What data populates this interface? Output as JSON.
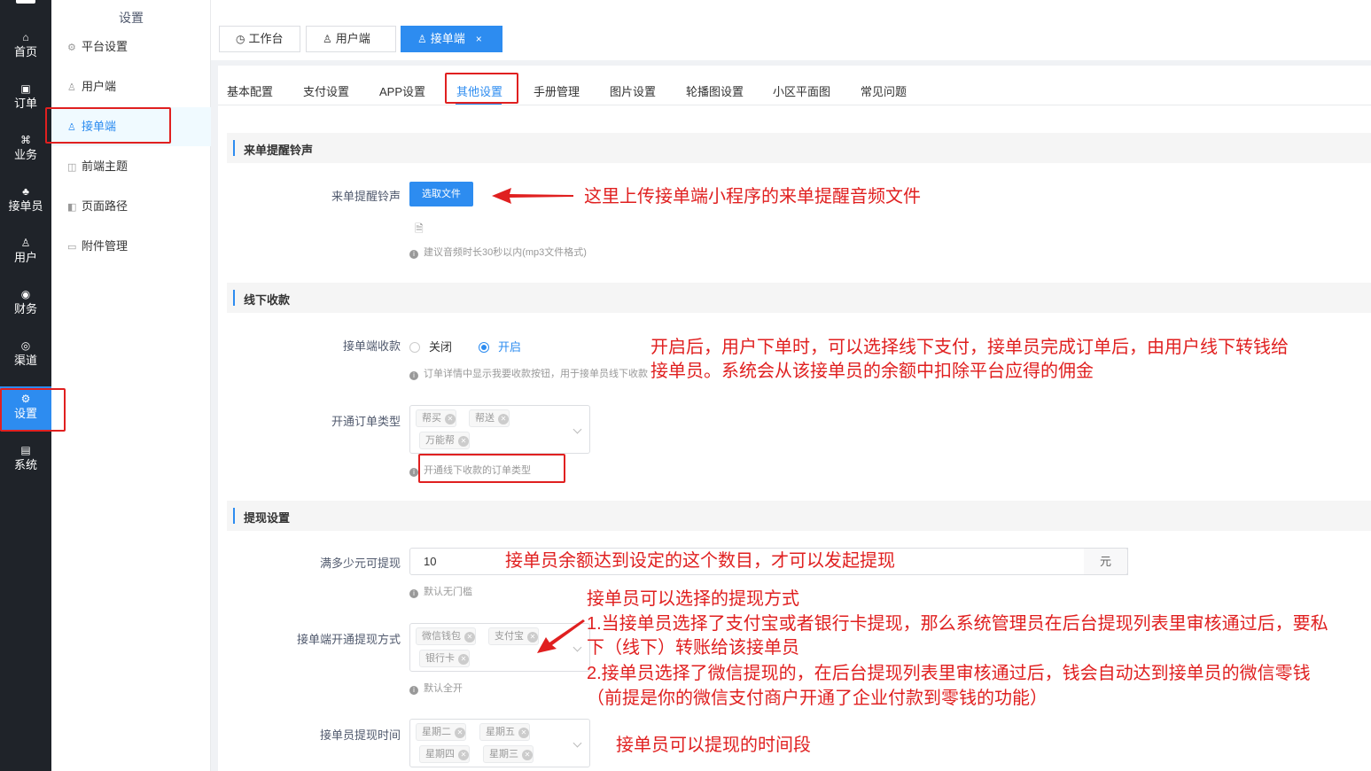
{
  "nav": {
    "items": [
      {
        "icon": "home-icon",
        "glyph": "⌂",
        "label": "首页"
      },
      {
        "icon": "order-icon",
        "glyph": "▣",
        "label": "订单"
      },
      {
        "icon": "business-icon",
        "glyph": "⌘",
        "label": "业务"
      },
      {
        "icon": "rider-icon",
        "glyph": "♣",
        "label": "接单员"
      },
      {
        "icon": "user-icon",
        "glyph": "♙",
        "label": "用户"
      },
      {
        "icon": "finance-icon",
        "glyph": "◉",
        "label": "财务"
      },
      {
        "icon": "channel-icon",
        "glyph": "◎",
        "label": "渠道"
      },
      {
        "icon": "settings-icon",
        "glyph": "⚙",
        "label": "设置"
      },
      {
        "icon": "system-icon",
        "glyph": "▤",
        "label": "系统"
      }
    ],
    "active_index": 7
  },
  "menu": {
    "title": "设置",
    "items": [
      {
        "icon": "gear-icon",
        "glyph": "⚙",
        "label": "平台设置"
      },
      {
        "icon": "user-icon",
        "glyph": "♙",
        "label": "用户端"
      },
      {
        "icon": "rider-icon",
        "glyph": "♙",
        "label": "接单端"
      },
      {
        "icon": "theme-icon",
        "glyph": "◫",
        "label": "前端主题"
      },
      {
        "icon": "path-icon",
        "glyph": "◧",
        "label": "页面路径"
      },
      {
        "icon": "archive-icon",
        "glyph": "▭",
        "label": "附件管理"
      }
    ],
    "active_index": 2
  },
  "page_tabs": {
    "workbench": "工作台",
    "user_client": "用户端",
    "order_client": "接单端",
    "close": "×"
  },
  "settings_tabs": [
    "基本配置",
    "支付设置",
    "APP设置",
    "其他设置",
    "手册管理",
    "图片设置",
    "轮播图设置",
    "小区平面图",
    "常见问题"
  ],
  "settings_active_tab": "其他设置",
  "ringtone": {
    "section_title": "来单提醒铃声",
    "label": "来单提醒铃声",
    "button": "选取文件",
    "tip": "建议音频时长30秒以内(mp3文件格式)"
  },
  "offline": {
    "section_title": "线下收款",
    "collect_label": "接单端收款",
    "option_off": "关闭",
    "option_on": "开启",
    "selected": "开启",
    "collect_tip": "订单详情中显示我要收款按钮，用于接单员线下收款",
    "types_label": "开通订单类型",
    "types": [
      "帮买",
      "帮送",
      "万能帮"
    ],
    "types_tip": "开通线下收款的订单类型"
  },
  "withdraw": {
    "section_title": "提现设置",
    "min_label": "满多少元可提现",
    "min_value": "10",
    "min_suffix": "元",
    "min_tip": "默认无门槛",
    "methods_label": "接单端开通提现方式",
    "methods": [
      "微信钱包",
      "支付宝",
      "银行卡"
    ],
    "methods_tip": "默认全开",
    "time_label": "接单员提现时间",
    "days": [
      "星期二",
      "星期五",
      "星期四",
      "星期三"
    ]
  },
  "annotations": {
    "ringtone": "这里上传接单端小程序的来单提醒音频文件",
    "offline_1": "开启后，用户下单时，可以选择线下支付，接单员完成订单后，由用户线下转钱给",
    "offline_2": "接单员。系统会从该接单员的余额中扣除平台应得的佣金",
    "min": "接单员余额达到设定的这个数目，才可以发起提现",
    "methods_1": "接单员可以选择的提现方式",
    "methods_2": "1.当接单员选择了支付宝或者银行卡提现，那么系统管理员在后台提现列表里审核通过后，要私",
    "methods_3": "下（线下）转账给该接单员",
    "methods_4": "2.接单员选择了微信提现的，在后台提现列表里审核通过后，钱会自动达到接单员的微信零钱",
    "methods_5": "（前提是你的微信支付商户开通了企业付款到零钱的功能）",
    "time": "接单员可以提现的时间段"
  },
  "colors": {
    "accent": "#2d8cf0",
    "annotation": "#e02020",
    "nav_bg": "#1f2329"
  }
}
